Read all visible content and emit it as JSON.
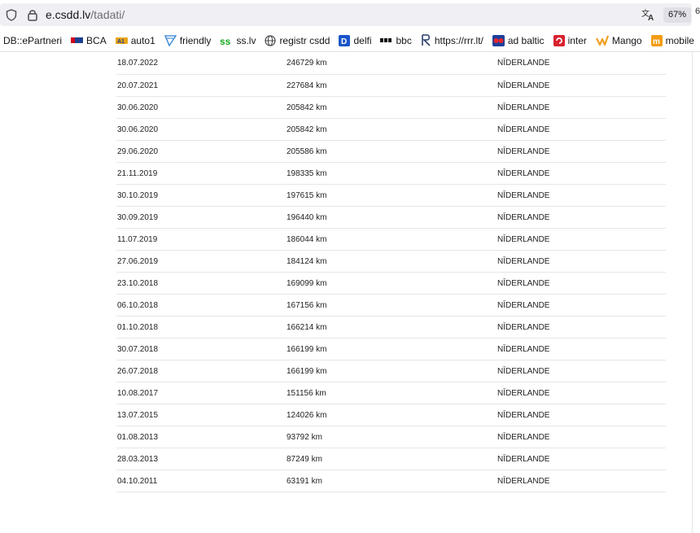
{
  "browser": {
    "url_domain": "e.csdd.lv",
    "url_path": "/tadati/",
    "zoom": "67%",
    "edge_glyph": "6"
  },
  "bookmarks": [
    {
      "label": "DB::ePartneri",
      "icon": "none"
    },
    {
      "label": "BCA",
      "icon": "bca-icon"
    },
    {
      "label": "auto1",
      "icon": "auto1-icon"
    },
    {
      "label": "friendly",
      "icon": "friendly-icon"
    },
    {
      "label": "ss.lv",
      "icon": "ss-icon"
    },
    {
      "label": "registr csdd",
      "icon": "globe-icon"
    },
    {
      "label": "delfi",
      "icon": "delfi-icon"
    },
    {
      "label": "bbc",
      "icon": "bbc-icon"
    },
    {
      "label": "https://rrr.lt/",
      "icon": "rrr-icon"
    },
    {
      "label": "ad baltic",
      "icon": "adbaltic-icon"
    },
    {
      "label": "inter",
      "icon": "inter-icon"
    },
    {
      "label": "Mango",
      "icon": "mango-icon"
    },
    {
      "label": "mobile",
      "icon": "mobile-icon"
    }
  ],
  "records": [
    {
      "date": "18.07.2022",
      "mileage": "246729 km",
      "country": "NĪDERLANDE"
    },
    {
      "date": "20.07.2021",
      "mileage": "227684 km",
      "country": "NĪDERLANDE"
    },
    {
      "date": "30.06.2020",
      "mileage": "205842 km",
      "country": "NĪDERLANDE"
    },
    {
      "date": "30.06.2020",
      "mileage": "205842 km",
      "country": "NĪDERLANDE"
    },
    {
      "date": "29.06.2020",
      "mileage": "205586 km",
      "country": "NĪDERLANDE"
    },
    {
      "date": "21.11.2019",
      "mileage": "198335 km",
      "country": "NĪDERLANDE"
    },
    {
      "date": "30.10.2019",
      "mileage": "197615 km",
      "country": "NĪDERLANDE"
    },
    {
      "date": "30.09.2019",
      "mileage": "196440 km",
      "country": "NĪDERLANDE"
    },
    {
      "date": "11.07.2019",
      "mileage": "186044 km",
      "country": "NĪDERLANDE"
    },
    {
      "date": "27.06.2019",
      "mileage": "184124 km",
      "country": "NĪDERLANDE"
    },
    {
      "date": "23.10.2018",
      "mileage": "169099 km",
      "country": "NĪDERLANDE"
    },
    {
      "date": "06.10.2018",
      "mileage": "167156 km",
      "country": "NĪDERLANDE"
    },
    {
      "date": "01.10.2018",
      "mileage": "166214 km",
      "country": "NĪDERLANDE"
    },
    {
      "date": "30.07.2018",
      "mileage": "166199 km",
      "country": "NĪDERLANDE"
    },
    {
      "date": "26.07.2018",
      "mileage": "166199 km",
      "country": "NĪDERLANDE"
    },
    {
      "date": "10.08.2017",
      "mileage": "151156 km",
      "country": "NĪDERLANDE"
    },
    {
      "date": "13.07.2015",
      "mileage": "124026 km",
      "country": "NĪDERLANDE"
    },
    {
      "date": "01.08.2013",
      "mileage": "93792 km",
      "country": "NĪDERLANDE"
    },
    {
      "date": "28.03.2013",
      "mileage": "87249 km",
      "country": "NĪDERLANDE"
    },
    {
      "date": "04.10.2011",
      "mileage": "63191 km",
      "country": "NĪDERLANDE"
    }
  ]
}
